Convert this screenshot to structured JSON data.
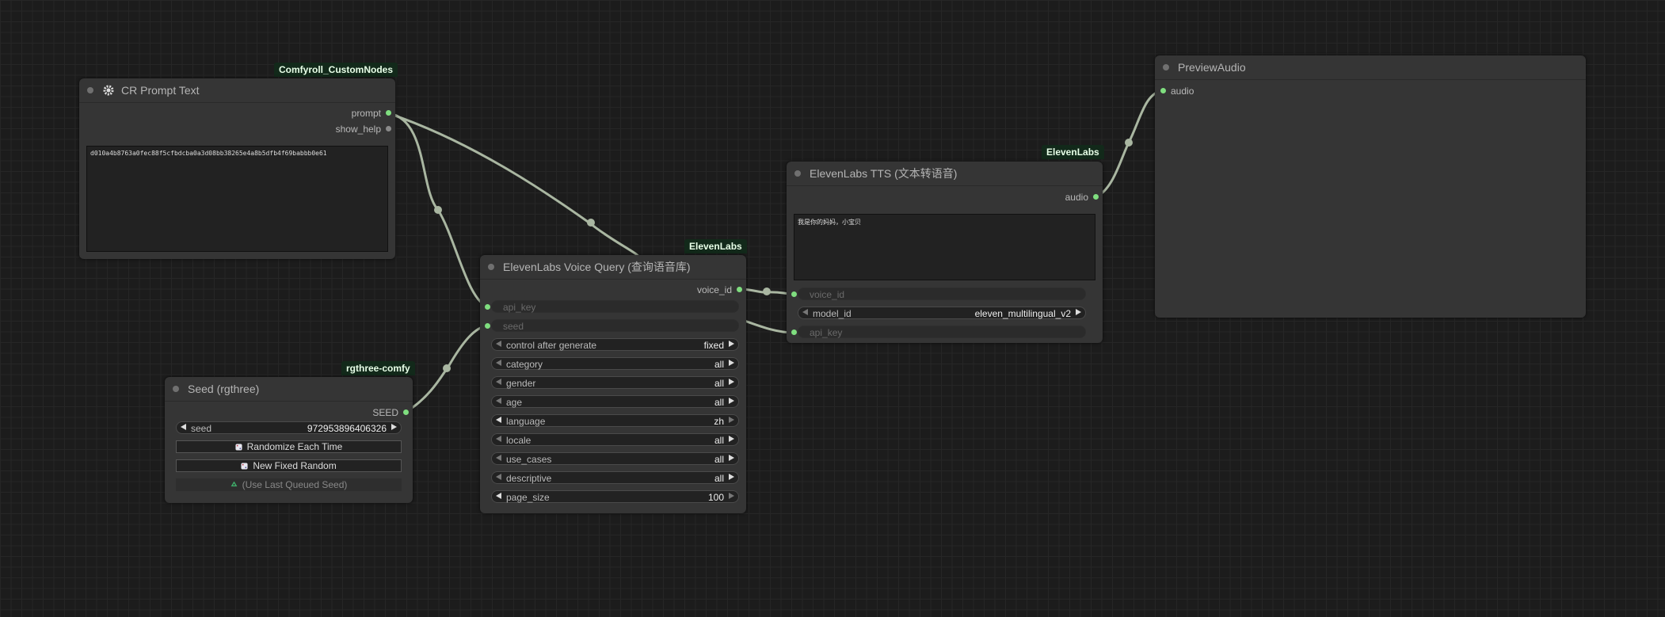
{
  "nodes": {
    "prompt_text": {
      "badge": "Comfyroll_CustomNodes",
      "title": "CR Prompt Text",
      "outputs": [
        "prompt",
        "show_help"
      ],
      "text": "d010a4b8763a0fec88f5cfbdcba0a3d08bb38265e4a8b5dfb4f69babbb0e61"
    },
    "seed": {
      "badge": "rgthree-comfy",
      "title": "Seed (rgthree)",
      "output": "SEED",
      "seed_label": "seed",
      "seed_value": "972953896406326",
      "btn_randomize": "Randomize Each Time",
      "btn_new_fixed": "New Fixed Random",
      "btn_last_queued": "(Use Last Queued Seed)"
    },
    "voice_query": {
      "badge": "ElevenLabs",
      "title": "ElevenLabs Voice Query (查询语音库)",
      "output": "voice_id",
      "inputs": [
        "api_key",
        "seed"
      ],
      "widgets": [
        {
          "label": "control after generate",
          "value": "fixed"
        },
        {
          "label": "category",
          "value": "all"
        },
        {
          "label": "gender",
          "value": "all"
        },
        {
          "label": "age",
          "value": "all"
        },
        {
          "label": "language",
          "value": "zh"
        },
        {
          "label": "locale",
          "value": "all"
        },
        {
          "label": "use_cases",
          "value": "all"
        },
        {
          "label": "descriptive",
          "value": "all"
        },
        {
          "label": "page_size",
          "value": "100"
        }
      ]
    },
    "tts": {
      "badge": "ElevenLabs",
      "title": "ElevenLabs TTS (文本转语音)",
      "output": "audio",
      "text": "我是你的妈妈，小宝贝",
      "input_voice_id": "voice_id",
      "model_label": "model_id",
      "model_value": "eleven_multilingual_v2",
      "input_api_key": "api_key"
    },
    "preview": {
      "title": "PreviewAudio",
      "input": "audio"
    }
  },
  "colors": {
    "link": "#a9b6a1",
    "slot": "#7fde7f",
    "badge_bg": "#12291a"
  }
}
